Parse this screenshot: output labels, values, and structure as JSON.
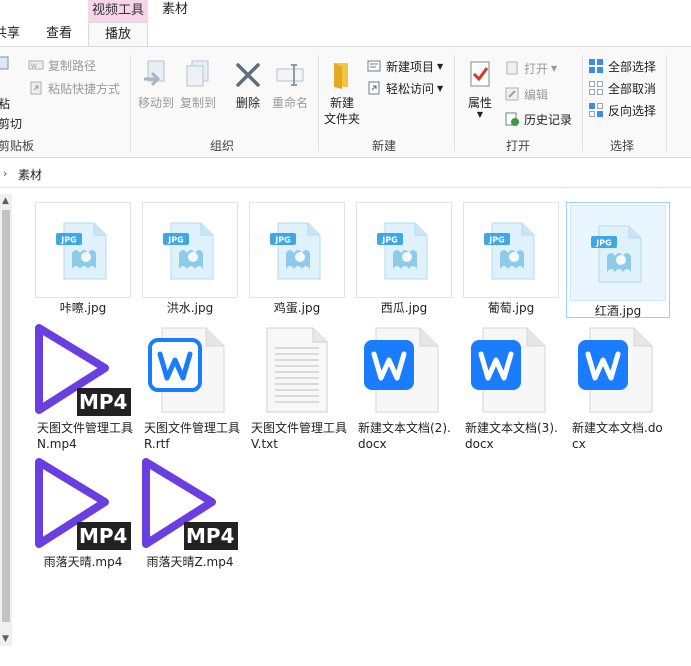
{
  "window": {
    "context_tab_group": "视频工具",
    "folder_title": "素材"
  },
  "tabs": {
    "share": "共享",
    "view": "查看",
    "play": "播放"
  },
  "ribbon": {
    "clipboard": {
      "label": "剪贴板",
      "paste": "粘",
      "cut": "剪切",
      "copy_path": "复制路径",
      "paste_shortcut": "粘贴快捷方式"
    },
    "organize": {
      "label": "组织",
      "move_to": "移动到",
      "copy_to": "复制到",
      "delete": "删除",
      "rename": "重命名"
    },
    "new": {
      "label": "新建",
      "new_folder_line1": "新建",
      "new_folder_line2": "文件夹",
      "new_item": "新建项目",
      "easy_access": "轻松访问"
    },
    "open": {
      "label": "打开",
      "properties": "属性",
      "open": "打开",
      "edit": "编辑",
      "history": "历史记录"
    },
    "select": {
      "label": "选择",
      "select_all": "全部选择",
      "select_none": "全部取消",
      "invert": "反向选择"
    }
  },
  "address": {
    "crumb": "素材"
  },
  "files": {
    "f1": {
      "name": "咔嚓.jpg",
      "badge": "JPG"
    },
    "f2": {
      "name": "洪水.jpg",
      "badge": "JPG"
    },
    "f3": {
      "name": "鸡蛋.jpg",
      "badge": "JPG"
    },
    "f4": {
      "name": "西瓜.jpg",
      "badge": "JPG"
    },
    "f5": {
      "name": "葡萄.jpg",
      "badge": "JPG"
    },
    "f6": {
      "name": "红酒.jpg",
      "badge": "JPG"
    },
    "f7": {
      "name": "天图文件管理工具N.mp4",
      "badge": "MP4"
    },
    "f8": {
      "name": "天图文件管理工具R.rtf"
    },
    "f9": {
      "name": "天图文件管理工具V.txt"
    },
    "f10": {
      "name": "新建文本文档(2).docx"
    },
    "f11": {
      "name": "新建文本文档(3).docx"
    },
    "f12": {
      "name": "新建文本文档.docx"
    },
    "f13": {
      "name": "雨落天晴.mp4",
      "badge": "MP4"
    },
    "f14": {
      "name": "雨落天晴Z.mp4",
      "badge": "MP4"
    }
  },
  "colors": {
    "mp4_purple": "#6a3ee0",
    "wps_blue": "#1a7cff",
    "jpg_blue": "#3ea7e8",
    "context_pink": "#f6d4ea"
  }
}
